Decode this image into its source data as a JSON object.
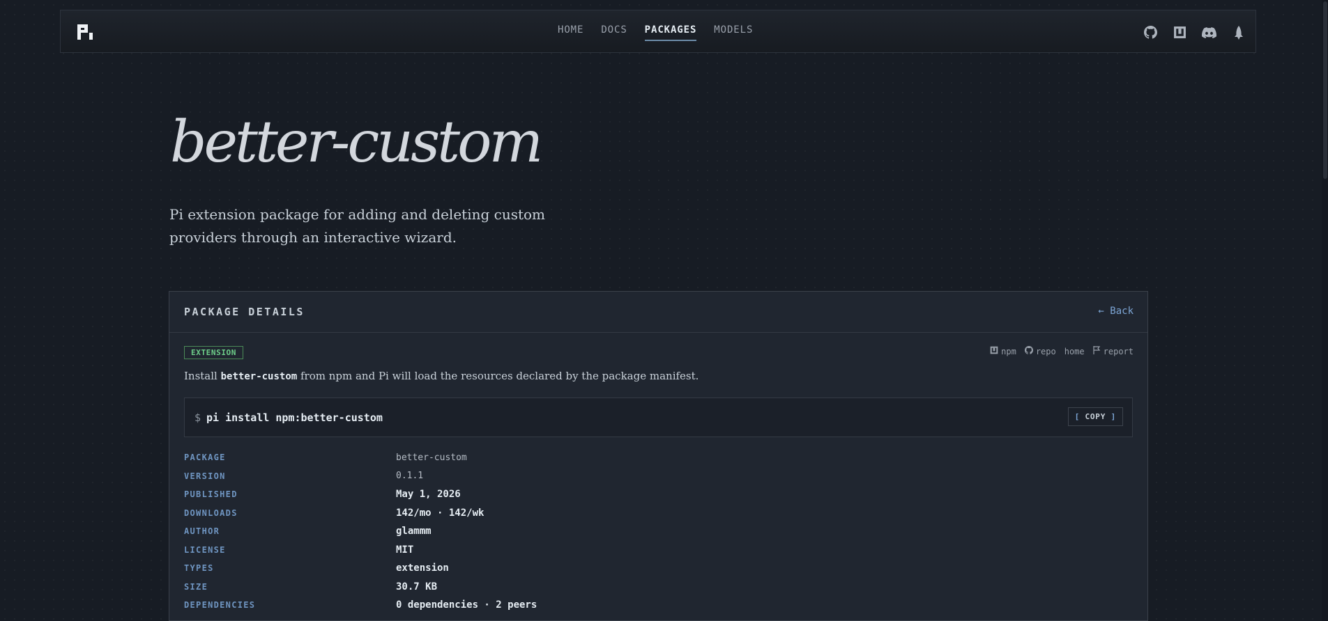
{
  "nav": {
    "items": [
      "HOME",
      "DOCS",
      "PACKAGES",
      "MODELS"
    ],
    "active": "PACKAGES",
    "icons": [
      "github-icon",
      "npm-icon",
      "discord-icon",
      "rocket-icon"
    ]
  },
  "hero": {
    "title": "better-custom",
    "description": "Pi extension package for adding and deleting custom providers through an interactive wizard."
  },
  "panel": {
    "title": "PACKAGE DETAILS",
    "back_label": "← Back",
    "badge": "EXTENSION",
    "links": [
      {
        "label": "npm",
        "icon": "npm-icon"
      },
      {
        "label": "repo",
        "icon": "github-icon"
      },
      {
        "label": "home",
        "icon": ""
      },
      {
        "label": "report",
        "icon": "flag-icon"
      }
    ],
    "install": {
      "prefix": "Install ",
      "package": "better-custom",
      "suffix": " from npm and Pi will load the resources declared by the package manifest."
    },
    "command": {
      "prompt": "$",
      "text": "pi install npm:better-custom",
      "copy_label": "COPY"
    },
    "details": [
      {
        "key": "PACKAGE",
        "value": "better-custom"
      },
      {
        "key": "VERSION",
        "value": "0.1.1"
      },
      {
        "key": "PUBLISHED",
        "value": "May 1, 2026"
      },
      {
        "key": "DOWNLOADS",
        "value": "142/mo · 142/wk"
      },
      {
        "key": "AUTHOR",
        "value": "glammm"
      },
      {
        "key": "LICENSE",
        "value": "MIT"
      },
      {
        "key": "TYPES",
        "value": "extension"
      },
      {
        "key": "SIZE",
        "value": "30.7 KB"
      },
      {
        "key": "DEPENDENCIES",
        "value": "0 dependencies · 2 peers"
      }
    ]
  },
  "colors": {
    "background": "#171c24",
    "panel": "#202630",
    "accent_blue": "#7da6d6",
    "badge_green": "#6ed08a"
  }
}
